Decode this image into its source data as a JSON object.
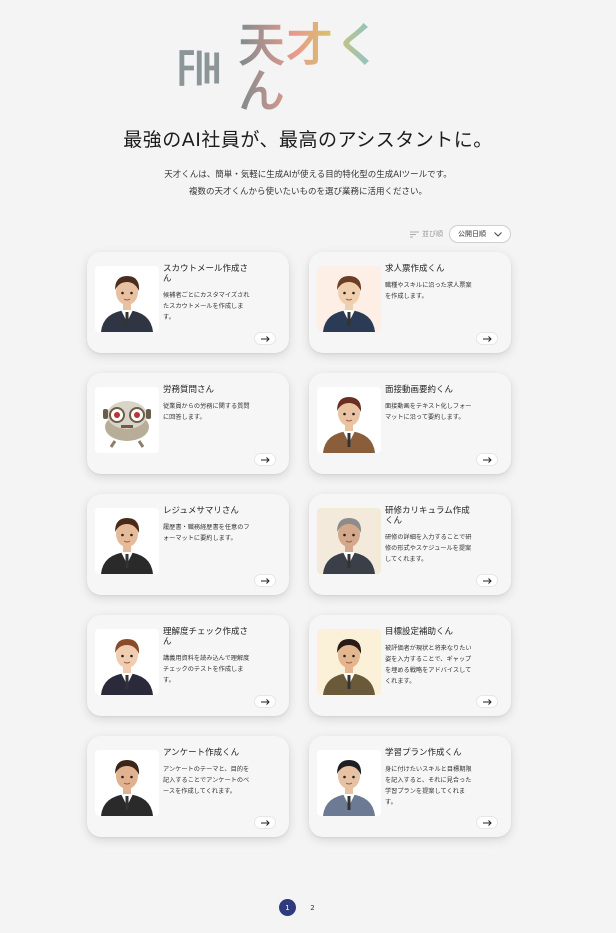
{
  "brand": {
    "logo_text": "天才くん"
  },
  "hero": {
    "headline": "最強のAI社員が、最高のアシスタントに。",
    "desc_line1": "天才くんは、簡単・気軽に生成AIが使える目的特化型の生成AIツールです。",
    "desc_line2": "複数の天才くんから使いたいものを選び業務に活用ください。"
  },
  "sort": {
    "label": "並び順",
    "selected": "公開日順"
  },
  "cards": [
    {
      "title": "スカウトメール作成さん",
      "desc": "候補者ごとにカスタマイズされたスカウトメールを作成します。",
      "icon": "avatar-woman-curly",
      "skin": "#e8c1a0",
      "hair": "#4a2d1e",
      "suit": "#2f3542",
      "bg": "#ffffff"
    },
    {
      "title": "求人票作成くん",
      "desc": "職種やスキルに沿った求人票案を作成します。",
      "icon": "avatar-young-man",
      "skin": "#efcfae",
      "hair": "#6b3d22",
      "suit": "#2b3a55",
      "bg": "#fdeee6"
    },
    {
      "title": "労務質問さん",
      "desc": "従業員からの労務に関する質問に回答します。",
      "icon": "robot-icon",
      "skin": "#d9d4c8",
      "hair": "#8d7f6a",
      "suit": "#b8ad98",
      "bg": "#ffffff"
    },
    {
      "title": "面接動画要約くん",
      "desc": "面接動画をテキスト化しフォーマットに沿って要約します。",
      "icon": "avatar-man-document",
      "skin": "#e9c3a2",
      "hair": "#6a2e22",
      "suit": "#8a5d3b",
      "bg": "#ffffff"
    },
    {
      "title": "レジュメサマリさん",
      "desc": "履歴書・職務経歴書を任意のフォーマットに要約します。",
      "icon": "avatar-woman-bob",
      "skin": "#e5bc9a",
      "hair": "#4a2918",
      "suit": "#2a2a2a",
      "bg": "#ffffff"
    },
    {
      "title": "研修カリキュラム作成くん",
      "desc": "研修の詳細を入力することで研修の形式やスケジュールを提案してくれます。",
      "icon": "avatar-gray-man",
      "skin": "#d4a88a",
      "hair": "#8c8c8c",
      "suit": "#3b3f47",
      "bg": "#f3eadb"
    },
    {
      "title": "理解度チェック作成さん",
      "desc": "講義用資料を読み込んで理解度チェックのテストを作成します。",
      "icon": "avatar-girl-sign",
      "skin": "#f0cdb0",
      "hair": "#8a4b2a",
      "suit": "#2a2a3a",
      "bg": "#ffffff"
    },
    {
      "title": "目標設定補助くん",
      "desc": "被評価者が現状と将来なりたい姿を入力することで、ギャップを埋める戦略をアドバイスしてくれます。",
      "icon": "avatar-man-suspenders",
      "skin": "#e3b690",
      "hair": "#2a1c14",
      "suit": "#6b5a3a",
      "bg": "#fbf1d8"
    },
    {
      "title": "アンケート作成くん",
      "desc": "アンケートのテーマと、目的を記入することでアンケートのベースを作成してくれます。",
      "icon": "avatar-man-microphone",
      "skin": "#e0b28f",
      "hair": "#3a2518",
      "suit": "#2a2a2a",
      "bg": "#ffffff"
    },
    {
      "title": "学習プラン作成くん",
      "desc": "身に付けたいスキルと目標期限を記入すると、それに見合った学習プランを提案してくれます。",
      "icon": "avatar-man-glasses",
      "skin": "#e6c2a3",
      "hair": "#1e1e26",
      "suit": "#6c7a93",
      "bg": "#ffffff"
    }
  ],
  "pagination": {
    "pages": [
      "1",
      "2"
    ],
    "current": "1"
  }
}
